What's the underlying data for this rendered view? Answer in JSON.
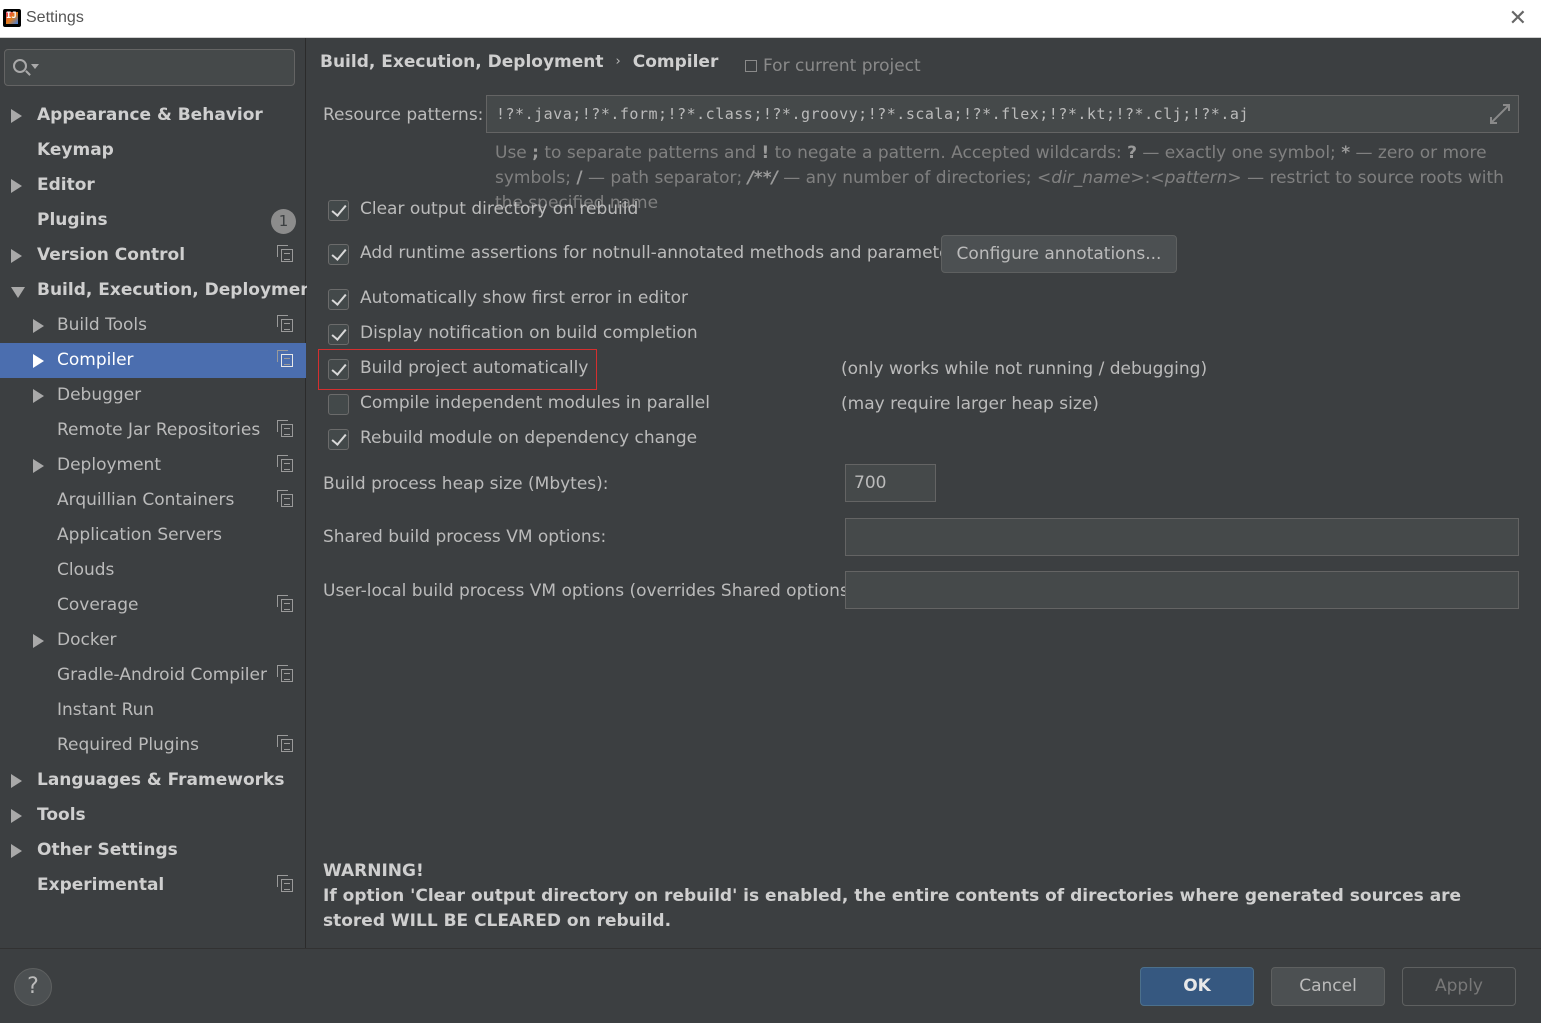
{
  "window": {
    "title": "Settings",
    "close_icon": "close-icon"
  },
  "sidebar": {
    "search_placeholder": "",
    "items": [
      {
        "label": "Appearance & Behavior",
        "level": 0,
        "arrow": "right"
      },
      {
        "label": "Keymap",
        "level": 0,
        "arrow": "none"
      },
      {
        "label": "Editor",
        "level": 0,
        "arrow": "right"
      },
      {
        "label": "Plugins",
        "level": 0,
        "arrow": "none",
        "badge": "1"
      },
      {
        "label": "Version Control",
        "level": 0,
        "arrow": "right",
        "project_icon": true
      },
      {
        "label": "Build, Execution, Deployment",
        "level": 0,
        "arrow": "down"
      },
      {
        "label": "Build Tools",
        "level": 1,
        "arrow": "right",
        "project_icon": true
      },
      {
        "label": "Compiler",
        "level": 1,
        "arrow": "right",
        "project_icon": true,
        "selected": true
      },
      {
        "label": "Debugger",
        "level": 1,
        "arrow": "right"
      },
      {
        "label": "Remote Jar Repositories",
        "level": 1,
        "arrow": "none",
        "project_icon": true
      },
      {
        "label": "Deployment",
        "level": 1,
        "arrow": "right",
        "project_icon": true
      },
      {
        "label": "Arquillian Containers",
        "level": 1,
        "arrow": "none",
        "project_icon": true
      },
      {
        "label": "Application Servers",
        "level": 1,
        "arrow": "none"
      },
      {
        "label": "Clouds",
        "level": 1,
        "arrow": "none"
      },
      {
        "label": "Coverage",
        "level": 1,
        "arrow": "none",
        "project_icon": true
      },
      {
        "label": "Docker",
        "level": 1,
        "arrow": "right"
      },
      {
        "label": "Gradle-Android Compiler",
        "level": 1,
        "arrow": "none",
        "project_icon": true
      },
      {
        "label": "Instant Run",
        "level": 1,
        "arrow": "none"
      },
      {
        "label": "Required Plugins",
        "level": 1,
        "arrow": "none",
        "project_icon": true
      },
      {
        "label": "Languages & Frameworks",
        "level": 0,
        "arrow": "right"
      },
      {
        "label": "Tools",
        "level": 0,
        "arrow": "right"
      },
      {
        "label": "Other Settings",
        "level": 0,
        "arrow": "right"
      },
      {
        "label": "Experimental",
        "level": 0,
        "arrow": "none",
        "project_icon": true
      }
    ]
  },
  "main": {
    "breadcrumb": {
      "parent": "Build, Execution, Deployment",
      "separator": "›",
      "current": "Compiler"
    },
    "scope": "For current project",
    "resource_patterns": {
      "label": "Resource patterns:",
      "value": "!?*.java;!?*.form;!?*.class;!?*.groovy;!?*.scala;!?*.flex;!?*.kt;!?*.clj;!?*.aj"
    },
    "hint": {
      "p1": "Use ",
      "b1": ";",
      "p2": " to separate patterns and ",
      "b2": "!",
      "p3": " to negate a pattern. Accepted wildcards: ",
      "b3": "?",
      "p4": " — exactly one symbol; ",
      "b4": "*",
      "p5": " — zero or more symbols; ",
      "b5": "/",
      "p6": " — path separator; ",
      "b6": "/**/",
      "p7": " — any number of directories; ",
      "i1": "<dir_name>",
      "p8": ":",
      "i2": "<pattern>",
      "p9": " — restrict to source roots with the specified name"
    },
    "options": {
      "clear_output": {
        "label": "Clear output directory on rebuild",
        "checked": true
      },
      "runtime_assertions": {
        "label": "Add runtime assertions for notnull-annotated methods and parameters",
        "checked": true
      },
      "configure_button": "Configure annotations...",
      "show_first_error": {
        "label": "Automatically show first error in editor",
        "checked": true
      },
      "display_notification": {
        "label": "Display notification on build completion",
        "checked": true
      },
      "build_automatically": {
        "label": "Build project automatically",
        "checked": true,
        "note": "(only works while not running / debugging)"
      },
      "compile_parallel": {
        "label": "Compile independent modules in parallel",
        "checked": false,
        "note": "(may require larger heap size)"
      },
      "rebuild_on_dependency": {
        "label": "Rebuild module on dependency change",
        "checked": true
      }
    },
    "heap": {
      "label": "Build process heap size (Mbytes):",
      "value": "700"
    },
    "shared_vm": {
      "label": "Shared build process VM options:",
      "value": ""
    },
    "local_vm": {
      "label": "User-local build process VM options (overrides Shared options):",
      "value": ""
    },
    "warning": {
      "title": "WARNING!",
      "text": "If option 'Clear output directory on rebuild' is enabled, the entire contents of directories where generated sources are stored WILL BE CLEARED on rebuild."
    }
  },
  "footer": {
    "help": "?",
    "ok": "OK",
    "cancel": "Cancel",
    "apply": "Apply"
  },
  "colors": {
    "background": "#3c3f41",
    "selection": "#4b6eaf",
    "ok_button": "#365880",
    "highlight": "#d42f2f"
  }
}
